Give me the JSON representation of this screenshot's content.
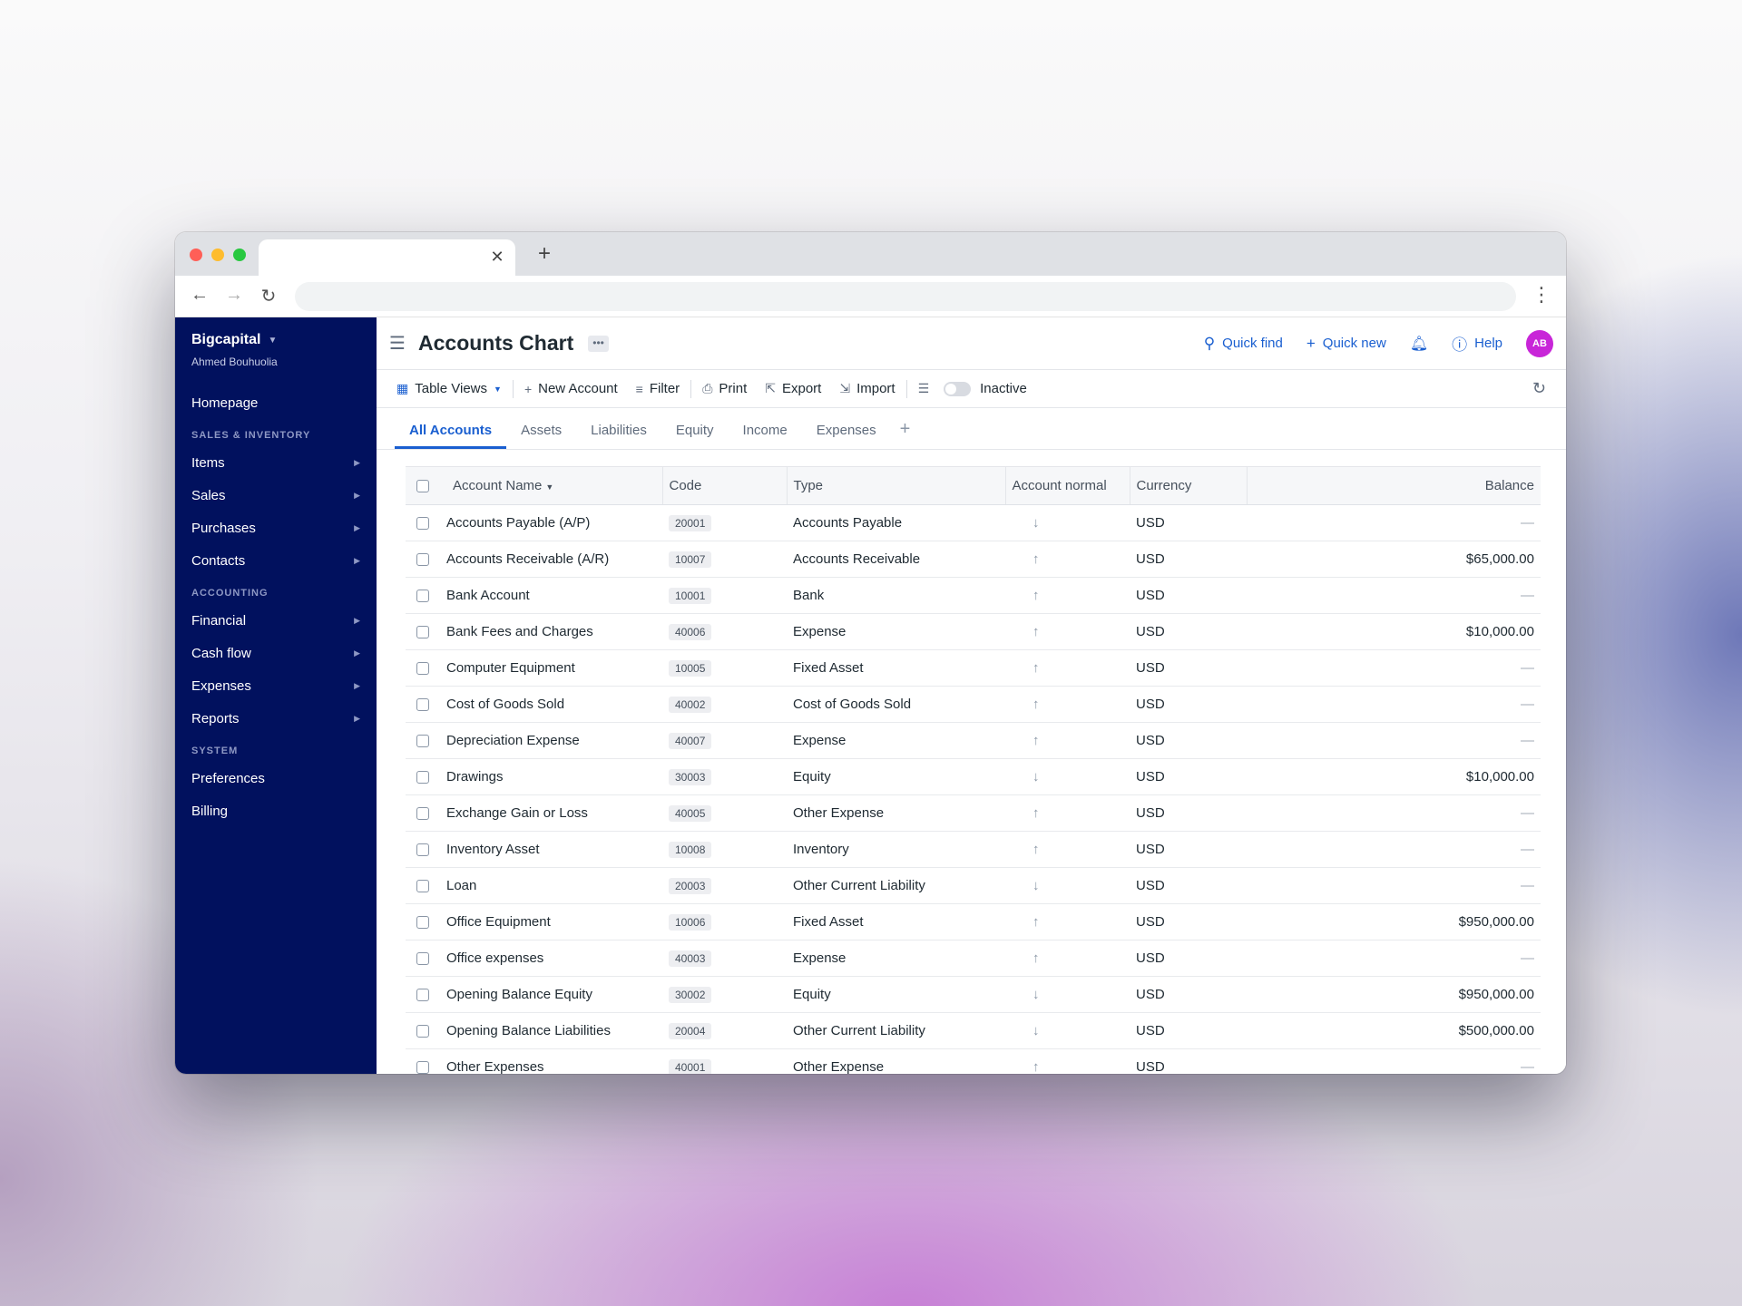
{
  "app": {
    "org_name": "Bigcapital",
    "user_name": "Ahmed Bouhuolia",
    "page_title": "Accounts Chart",
    "avatar_initials": "AB"
  },
  "sidebar": {
    "items_top": [
      {
        "label": "Homepage"
      }
    ],
    "section_sales": "SALES & INVENTORY",
    "items_sales": [
      {
        "label": "Items"
      },
      {
        "label": "Sales"
      },
      {
        "label": "Purchases"
      },
      {
        "label": "Contacts"
      }
    ],
    "section_accounting": "ACCOUNTING",
    "items_accounting": [
      {
        "label": "Financial"
      },
      {
        "label": "Cash flow"
      },
      {
        "label": "Expenses"
      },
      {
        "label": "Reports"
      }
    ],
    "section_system": "SYSTEM",
    "items_system": [
      {
        "label": "Preferences"
      },
      {
        "label": "Billing"
      }
    ]
  },
  "topbar": {
    "quick_find": "Quick find",
    "quick_new": "Quick new",
    "help": "Help"
  },
  "toolbar": {
    "table_views": "Table Views",
    "new_account": "New Account",
    "filter": "Filter",
    "print": "Print",
    "export": "Export",
    "import": "Import",
    "inactive": "Inactive"
  },
  "tabs": [
    "All Accounts",
    "Assets",
    "Liabilities",
    "Equity",
    "Income",
    "Expenses"
  ],
  "table": {
    "columns": {
      "name": "Account Name",
      "code": "Code",
      "type": "Type",
      "normal": "Account normal",
      "currency": "Currency",
      "balance": "Balance"
    },
    "rows": [
      {
        "name": "Accounts Payable (A/P)",
        "code": "20001",
        "type": "Accounts Payable",
        "normal": "credit",
        "currency": "USD",
        "balance": "—"
      },
      {
        "name": "Accounts Receivable (A/R)",
        "code": "10007",
        "type": "Accounts Receivable",
        "normal": "debit",
        "currency": "USD",
        "balance": "$65,000.00"
      },
      {
        "name": "Bank Account",
        "code": "10001",
        "type": "Bank",
        "normal": "debit",
        "currency": "USD",
        "balance": "—"
      },
      {
        "name": "Bank Fees and Charges",
        "code": "40006",
        "type": "Expense",
        "normal": "debit",
        "currency": "USD",
        "balance": "$10,000.00"
      },
      {
        "name": "Computer Equipment",
        "code": "10005",
        "type": "Fixed Asset",
        "normal": "debit",
        "currency": "USD",
        "balance": "—"
      },
      {
        "name": "Cost of Goods Sold",
        "code": "40002",
        "type": "Cost of Goods Sold",
        "normal": "debit",
        "currency": "USD",
        "balance": "—"
      },
      {
        "name": "Depreciation Expense",
        "code": "40007",
        "type": "Expense",
        "normal": "debit",
        "currency": "USD",
        "balance": "—"
      },
      {
        "name": "Drawings",
        "code": "30003",
        "type": "Equity",
        "normal": "credit",
        "currency": "USD",
        "balance": "$10,000.00"
      },
      {
        "name": "Exchange Gain or Loss",
        "code": "40005",
        "type": "Other Expense",
        "normal": "debit",
        "currency": "USD",
        "balance": "—"
      },
      {
        "name": "Inventory Asset",
        "code": "10008",
        "type": "Inventory",
        "normal": "debit",
        "currency": "USD",
        "balance": "—"
      },
      {
        "name": "Loan",
        "code": "20003",
        "type": "Other Current Liability",
        "normal": "credit",
        "currency": "USD",
        "balance": "—"
      },
      {
        "name": "Office Equipment",
        "code": "10006",
        "type": "Fixed Asset",
        "normal": "debit",
        "currency": "USD",
        "balance": "$950,000.00"
      },
      {
        "name": "Office expenses",
        "code": "40003",
        "type": "Expense",
        "normal": "debit",
        "currency": "USD",
        "balance": "—"
      },
      {
        "name": "Opening Balance Equity",
        "code": "30002",
        "type": "Equity",
        "normal": "credit",
        "currency": "USD",
        "balance": "$950,000.00"
      },
      {
        "name": "Opening Balance Liabilities",
        "code": "20004",
        "type": "Other Current Liability",
        "normal": "credit",
        "currency": "USD",
        "balance": "$500,000.00"
      },
      {
        "name": "Other Expenses",
        "code": "40001",
        "type": "Other Expense",
        "normal": "debit",
        "currency": "USD",
        "balance": "—"
      }
    ]
  },
  "colors": {
    "sidebar_bg": "#01115e",
    "accent": "#1a5fd0",
    "avatar": "#c826d8"
  }
}
